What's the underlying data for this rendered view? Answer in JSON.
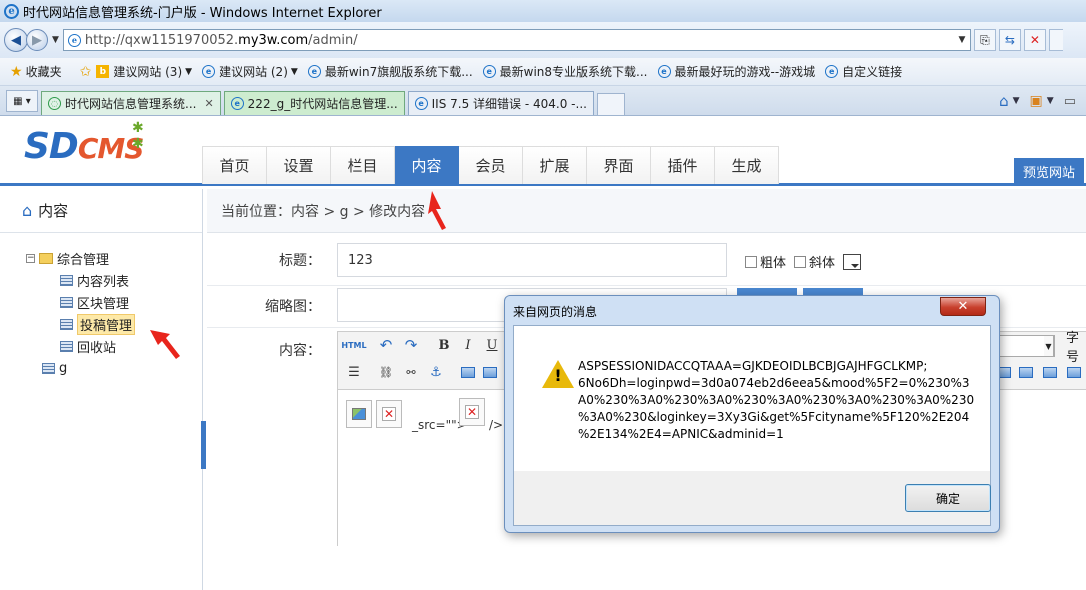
{
  "window": {
    "title": "时代网站信息管理系统-门户版 - Windows Internet Explorer"
  },
  "address_bar": {
    "url_prefix": "http://qxw1151970052.",
    "url_host": "my3w.com",
    "url_suffix": "/admin/"
  },
  "favorites_bar": {
    "favorites_label": "收藏夹",
    "items": [
      "建议网站 (3)",
      "建议网站 (2)",
      "最新win7旗舰版系统下载...",
      "最新win8专业版系统下载...",
      "最新最好玩的游戏--游戏城",
      "自定义链接"
    ]
  },
  "browser_tabs": [
    {
      "label": "时代网站信息管理系统..."
    },
    {
      "label": "222_g_时代网站信息管理..."
    },
    {
      "label": "IIS 7.5 详细错误 - 404.0 -..."
    }
  ],
  "cms": {
    "logo_sd": "SD",
    "logo_cms": "CMS",
    "nav": [
      "首页",
      "设置",
      "栏目",
      "内容",
      "会员",
      "扩展",
      "界面",
      "插件",
      "生成"
    ],
    "active_nav": "内容",
    "preview_button": "预览网站"
  },
  "sidebar": {
    "heading": "内容",
    "tree": {
      "root": "综合管理",
      "children": [
        "内容列表",
        "区块管理",
        "投稿管理",
        "回收站"
      ],
      "highlighted": "投稿管理",
      "second_root": "g"
    }
  },
  "breadcrumb": "当前位置：内容 > g > 修改内容",
  "form": {
    "title_label": "标题：",
    "title_value": "123",
    "bold_label": "粗体",
    "italic_label": "斜体",
    "thumb_label": "缩略图：",
    "content_label": "内容：",
    "font_size_label": "字号",
    "editor_src_text": "_src=\"\">",
    "editor_close_text": "/>"
  },
  "dialog": {
    "title": "来自网页的消息",
    "message_lines": [
      "ASPSESSIONIDACCQTAAA=GJKDEOIDLBCBJGAJHFGCLKMP;",
      "6No6Dh=loginpwd=3d0a074eb2d6eea5&mood%5F2=0%230%3",
      "A0%230%3A0%230%3A0%230%3A0%230%3A0%230%3A0%230",
      "%3A0%230&loginkey=3Xy3Gi&get%5Fcityname%5F120%2E204",
      "%2E134%2E4=APNIC&adminid=1"
    ],
    "ok_button": "确定"
  },
  "colors": {
    "accent": "#3c78c4",
    "annotation_arrow": "#e8251c"
  }
}
